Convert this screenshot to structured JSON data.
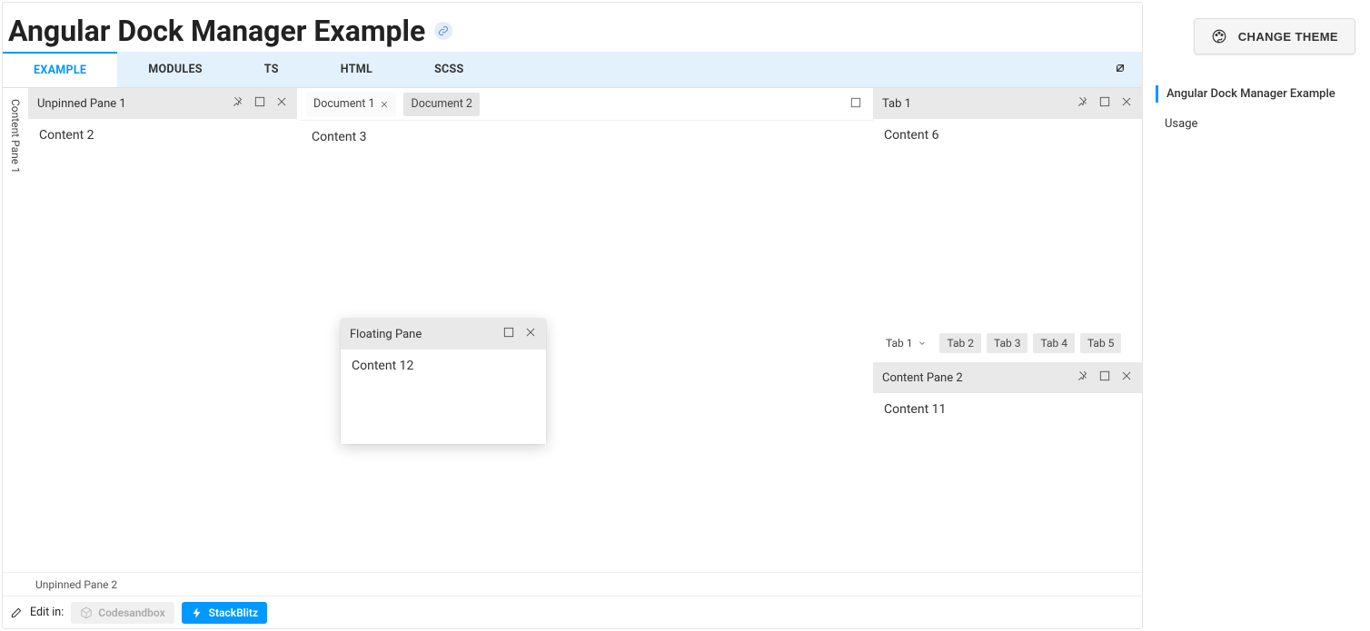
{
  "header": {
    "title": "Angular Dock Manager Example",
    "change_theme": "CHANGE THEME"
  },
  "tabs": {
    "example": "EXAMPLE",
    "modules": "MODULES",
    "ts": "TS",
    "html": "HTML",
    "scss": "SCSS"
  },
  "left_strip": {
    "label": "Content Pane 1"
  },
  "unpinned": {
    "header": "Unpinned Pane 1",
    "body": "Content 2"
  },
  "documents": {
    "doc1": "Document 1",
    "doc2": "Document 2",
    "body": "Content 3"
  },
  "right_tabs": {
    "header": "Tab 1",
    "body": "Content 6",
    "strip": {
      "t1": "Tab 1",
      "t2": "Tab 2",
      "t3": "Tab 3",
      "t4": "Tab 4",
      "t5": "Tab 5"
    }
  },
  "right_lower": {
    "header": "Content Pane 2",
    "body": "Content 11"
  },
  "floating": {
    "header": "Floating Pane",
    "body": "Content 12"
  },
  "bottom_strip": {
    "label": "Unpinned Pane 2"
  },
  "editbar": {
    "label": "Edit in:",
    "codesandbox": "Codesandbox",
    "stackblitz": "StackBlitz"
  },
  "toc": {
    "item1": "Angular Dock Manager Example",
    "item2": "Usage"
  }
}
